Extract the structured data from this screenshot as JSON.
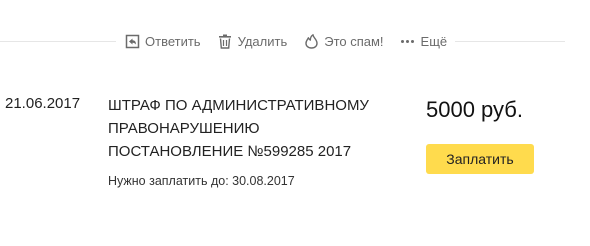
{
  "toolbar": {
    "actions": [
      {
        "icon": "reply-icon",
        "label": "Ответить"
      },
      {
        "icon": "trash-icon",
        "label": "Удалить"
      },
      {
        "icon": "spam-icon",
        "label": "Это спам!"
      },
      {
        "icon": "more-icon",
        "label": "Ещё"
      }
    ]
  },
  "bill": {
    "date": "21.06.2017",
    "title_lines": [
      "ШТРАФ ПО АДМИНИСТРАТИВНОМУ",
      "ПРАВОНАРУШЕНИЮ",
      "ПОСТАНОВЛЕНИЕ №599285 2017"
    ],
    "due": "Нужно заплатить до: 30.08.2017",
    "amount": "5000 руб.",
    "pay_label": "Заплатить"
  },
  "colors": {
    "pay_button": "#ffdb4d",
    "toolbar_text": "#6b6b6b",
    "divider": "#e6e6e6"
  }
}
